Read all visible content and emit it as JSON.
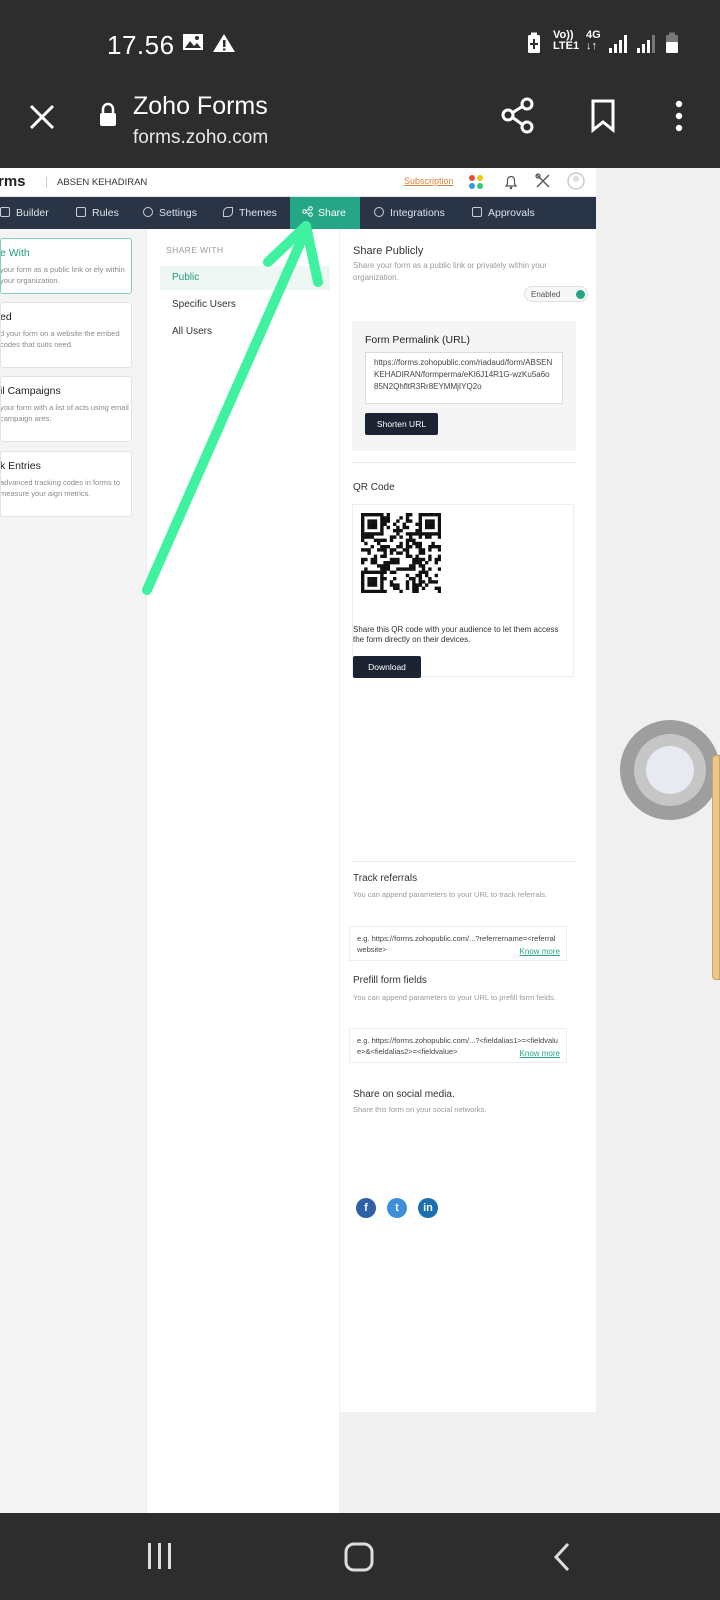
{
  "status_bar": {
    "time": "17.56",
    "network_label_top": "Vo))",
    "network_label_bottom": "LTE1",
    "data_type": "4G"
  },
  "browser": {
    "title": "Zoho Forms",
    "url": "forms.zoho.com"
  },
  "app": {
    "brand": "rms",
    "form_name": "ABSEN KEHADIRAN",
    "subscription": "Subscription"
  },
  "nav": {
    "items": [
      {
        "label": "Builder"
      },
      {
        "label": "Rules"
      },
      {
        "label": "Settings"
      },
      {
        "label": "Themes"
      },
      {
        "label": "Share"
      },
      {
        "label": "Integrations"
      },
      {
        "label": "Approvals"
      }
    ]
  },
  "left_cards": [
    {
      "title": "e With",
      "desc": "your form as a public link or ely within your organization."
    },
    {
      "title": "ed",
      "desc": "d your form on a website the embed codes that suits need."
    },
    {
      "title": "il Campaigns",
      "desc": "your form with a list of acts using email campaign ares."
    },
    {
      "title": "k Entries",
      "desc": "advanced tracking codes in forms to measure your aign metrics."
    }
  ],
  "share_with": {
    "heading": "SHARE WITH",
    "items": [
      {
        "label": "Public"
      },
      {
        "label": "Specific Users"
      },
      {
        "label": "All Users"
      }
    ]
  },
  "public_panel": {
    "title": "Share Publicly",
    "subtitle": "Share your form as a public link or privately within your organization.",
    "toggle_label": "Enabled",
    "permalink_label": "Form Permalink (URL)",
    "permalink_url": "https://forms.zohopublic.com/riadaud/form/ABSENKEHADIRAN/formperma/eKI6J14R1G-wzKu5a6o85N2QhfltR3Rr8EYMMjIYQ2o",
    "shorten_button": "Shorten URL",
    "qr_label": "QR Code",
    "qr_desc": "Share this QR code with your audience to let them access the form directly on their devices.",
    "download_button": "Download",
    "track_title": "Track referrals",
    "track_sub": "You can append parameters to your URL to track referrals.",
    "track_example": "e.g. https://forms.zohopublic.com/...?referrername=<referralwebsite>",
    "prefill_title": "Prefill form fields",
    "prefill_sub": "You can append parameters to your URL to prefill form fields.",
    "prefill_example": "e.g. https://forms.zohopublic.com/...?<fieldalias1>=<fieldvalue>&<fieldalias2>=<fieldvalue>",
    "know_more": "Know more",
    "social_title": "Share on social media.",
    "social_sub": "Share this form on your social networks.",
    "social_icons": [
      "facebook-icon",
      "twitter-icon",
      "linkedin-icon"
    ]
  },
  "colors": {
    "accent": "#24a687",
    "nav_bg": "#2a3447",
    "arrow": "#3ef2a0",
    "subscription": "#d9813b"
  }
}
